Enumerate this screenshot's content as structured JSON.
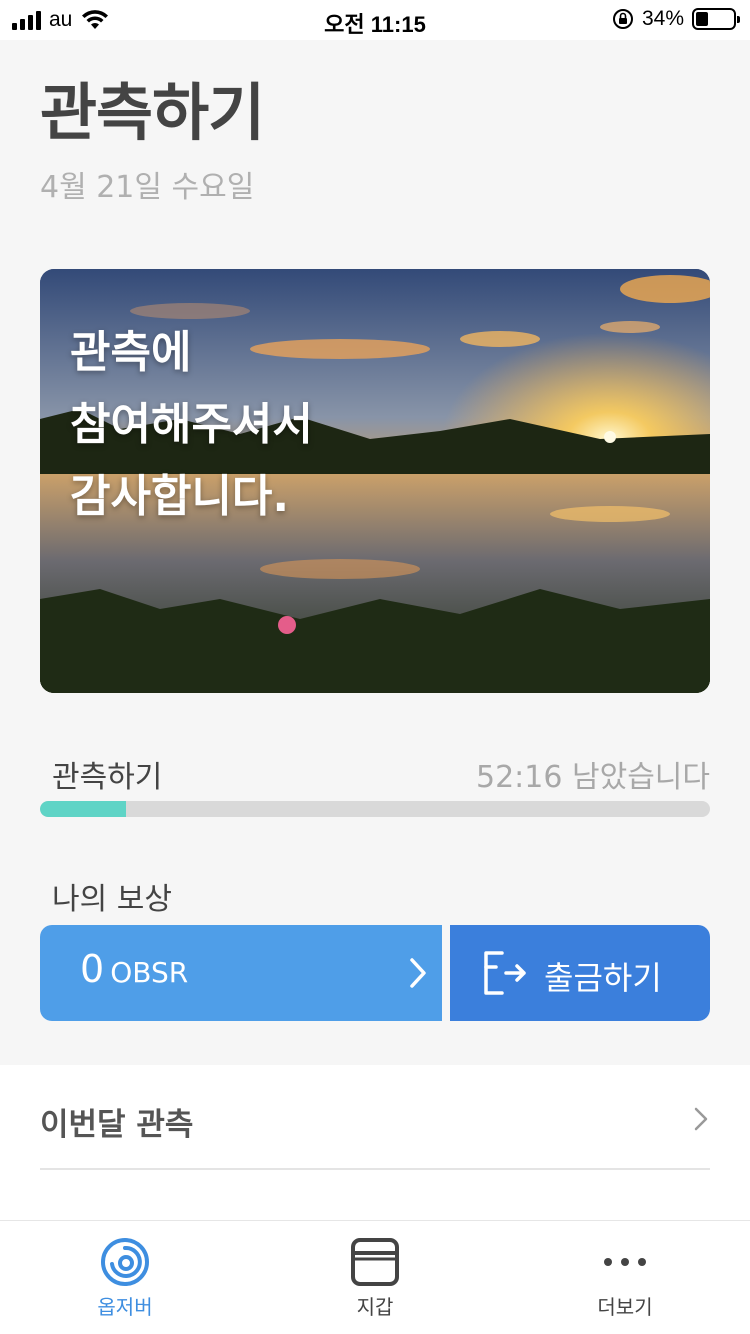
{
  "status_bar": {
    "carrier": "au",
    "time": "오전 11:15",
    "battery": "34%",
    "icons": [
      "signal-icon",
      "wifi-icon",
      "orientation-lock-icon",
      "battery-icon"
    ]
  },
  "header": {
    "title": "관측하기",
    "date": "4월 21일 수요일"
  },
  "hero": {
    "message": "관측에\n참여해주셔서\n감사합니다."
  },
  "observation": {
    "label": "관측하기",
    "remaining": "52:16 남았습니다",
    "progress_fraction": 0.128
  },
  "rewards": {
    "label": "나의 보상",
    "amount": "0",
    "unit": "OBSR",
    "withdraw_label": "출금하기"
  },
  "monthly": {
    "title": "이번달 관측"
  },
  "tabbar": {
    "tabs": [
      {
        "label": "옵저버",
        "icon": "observer-logo-icon",
        "active": true
      },
      {
        "label": "지갑",
        "icon": "wallet-icon",
        "active": false
      },
      {
        "label": "더보기",
        "icon": "more-dots-icon",
        "active": false
      }
    ]
  },
  "colors": {
    "accent_blue": "#4f9ee8",
    "withdraw_blue": "#3b7fdc",
    "progress_teal": "#5fd4c6",
    "tab_active": "#3e8ee0"
  }
}
